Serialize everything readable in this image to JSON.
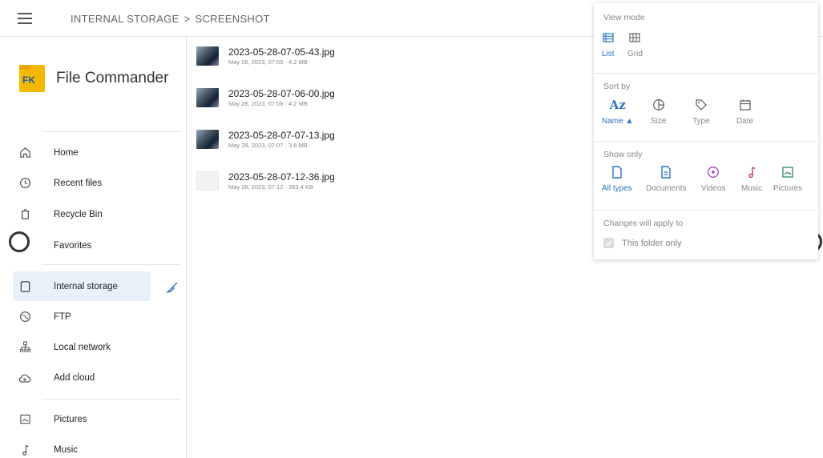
{
  "topbar": {
    "menu_icon": "hamburger-menu-icon",
    "breadcrumb": [
      "INTERNAL STORAGE",
      "SCREENSHOT"
    ],
    "breadcrumb_separator": ">"
  },
  "sidebar": {
    "app_logo_text": "FK",
    "app_name": "File Commander",
    "items": [
      {
        "label": "Home",
        "icon": "home-icon"
      },
      {
        "label": "Recent files",
        "icon": "clock-icon"
      },
      {
        "label": "Recycle Bin",
        "icon": "trash-icon"
      },
      {
        "label": "Favorites",
        "icon": "star-icon"
      },
      {
        "label": "Internal storage",
        "icon": "tablet-icon",
        "active": true
      },
      {
        "label": "FTP",
        "icon": "globe-icon"
      },
      {
        "label": "Local network",
        "icon": "network-icon"
      },
      {
        "label": "Add cloud",
        "icon": "cloud-add-icon"
      },
      {
        "label": "Pictures",
        "icon": "image-icon"
      },
      {
        "label": "Music",
        "icon": "music-icon"
      }
    ]
  },
  "files": [
    {
      "name": "2023-05-28-07-05-43.jpg",
      "meta": "May 28, 2023, 07:05 · 4.2 MB"
    },
    {
      "name": "2023-05-28-07-06-00.jpg",
      "meta": "May 28, 2023, 07:06 · 4.2 MB"
    },
    {
      "name": "2023-05-28-07-07-13.jpg",
      "meta": "May 28, 2023, 07:07 · 3.6 MB"
    },
    {
      "name": "2023-05-28-07-12-36.jpg",
      "meta": "May 28, 2023, 07:12 · 353.4 KB"
    }
  ],
  "panel": {
    "view_mode": {
      "title": "View mode",
      "options": [
        {
          "label": "List",
          "icon": "list-view-icon",
          "selected": true
        },
        {
          "label": "Grid",
          "icon": "grid-view-icon"
        }
      ]
    },
    "sort_by": {
      "title": "Sort by",
      "options": [
        {
          "label": "Name ▲",
          "icon": "sort-az-icon",
          "selected": true
        },
        {
          "label": "Size",
          "icon": "pie-size-icon"
        },
        {
          "label": "Type",
          "icon": "tag-icon"
        },
        {
          "label": "Date",
          "icon": "calendar-icon"
        }
      ]
    },
    "show_only": {
      "title": "Show only",
      "options": [
        {
          "label": "All types",
          "icon": "file-icon",
          "selected": true,
          "color": "#2d72c4"
        },
        {
          "label": "Documents",
          "icon": "document-icon",
          "color": "#2d72c4"
        },
        {
          "label": "Videos",
          "icon": "play-circle-icon",
          "color": "#a040c0"
        },
        {
          "label": "Music",
          "icon": "music-note-icon",
          "color": "#c0307a"
        },
        {
          "label": "Pictures",
          "icon": "picture-icon",
          "color": "#2a8a6a"
        }
      ]
    },
    "changes": {
      "title": "Changes will apply to",
      "checkbox_label": "This folder only",
      "checked": true
    }
  },
  "colors": {
    "accent": "#2d72c4",
    "active_nav_bg": "#e8f1fa",
    "logo_yellow": "#f5b800"
  }
}
